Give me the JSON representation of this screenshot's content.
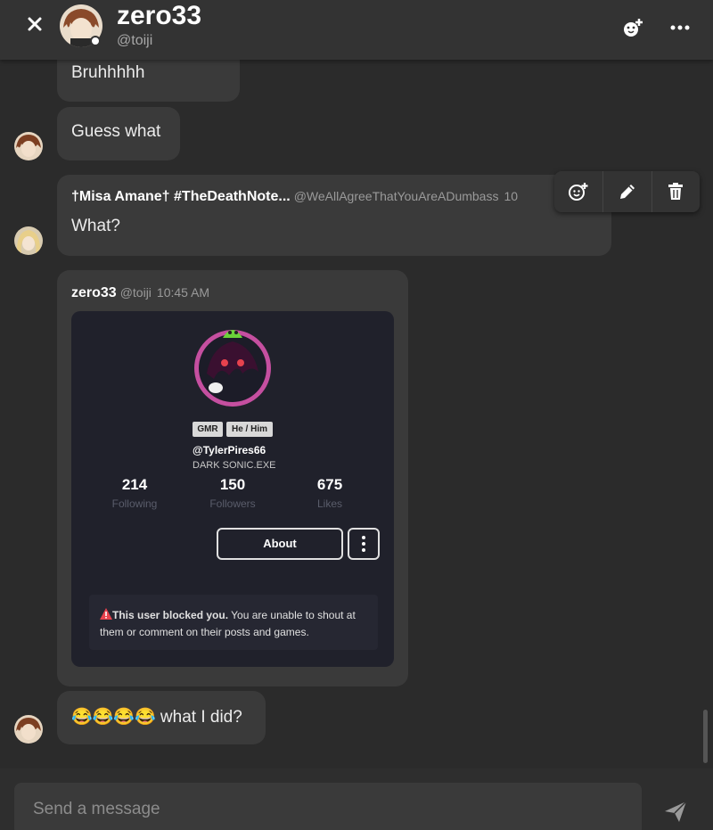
{
  "header": {
    "name": "zero33",
    "handle": "@toiji",
    "close_icon": "close-icon",
    "add_member_icon": "add-member-icon",
    "more_icon": "more-horizontal-icon"
  },
  "messages": [
    {
      "text": "Bruhhhhh"
    },
    {
      "text": "Guess what"
    },
    {
      "author": "†Misa Amane† #TheDeathNote...",
      "handle": "@WeAllAgreeThatYouAreADumbass",
      "time": "10",
      "text": "What?"
    },
    {
      "author": "zero33",
      "handle": "@toiji",
      "time": "10:45 AM"
    },
    {
      "emoji": "😂😂😂😂",
      "text": "what I did?"
    }
  ],
  "toolbar": {
    "react_icon": "add-reaction-icon",
    "edit_icon": "pencil-icon",
    "delete_icon": "trash-icon"
  },
  "embed": {
    "badges": [
      "GMR",
      "He / Him"
    ],
    "username": "@TylerPires66",
    "display_name": "DARK SONIC.EXE",
    "stats": [
      {
        "value": "214",
        "label": "Following"
      },
      {
        "value": "150",
        "label": "Followers"
      },
      {
        "value": "675",
        "label": "Likes"
      }
    ],
    "about_label": "About",
    "blocked_title": "This user blocked you.",
    "blocked_text": " You are unable to shout at them or comment on their posts and games."
  },
  "composer": {
    "placeholder": "Send a message",
    "send_icon": "send-icon"
  },
  "colors": {
    "background": "#2b2b2b",
    "bubble": "#3a3a3a",
    "embed_bg": "#20212b",
    "warning": "#e8424e",
    "ring": "#c54fa0"
  }
}
